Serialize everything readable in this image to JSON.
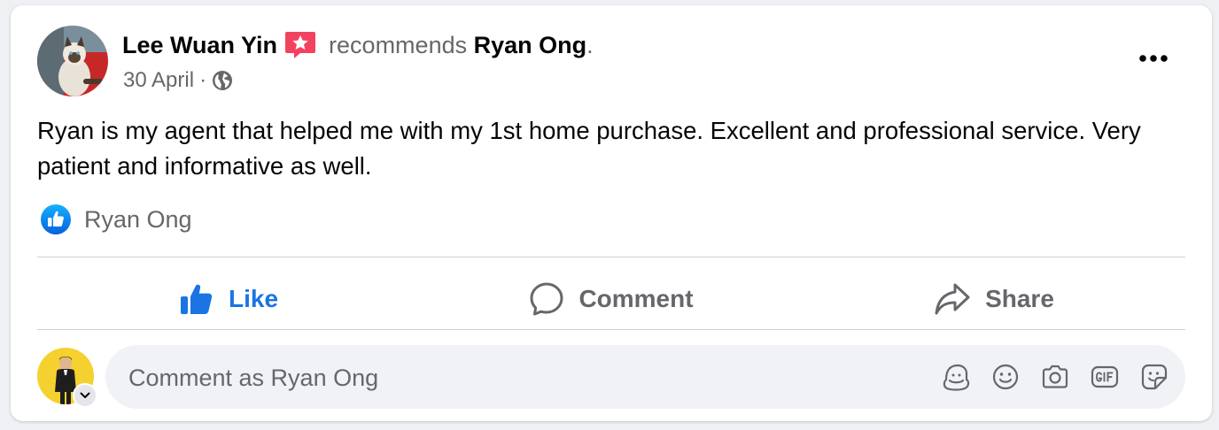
{
  "post": {
    "author": "Lee Wuan Yin",
    "verb": "recommends",
    "page": "Ryan Ong",
    "period": ".",
    "date": "30 April",
    "separator": "·",
    "privacy_icon": "globe-icon",
    "body": "Ryan is my agent that helped me with my 1st home purchase. Excellent and professional service. Very patient and informative as well.",
    "more_icon": "more-horizontal-icon"
  },
  "reactions": {
    "icon": "like-reaction-icon",
    "name": "Ryan Ong"
  },
  "actions": {
    "like": "Like",
    "comment": "Comment",
    "share": "Share"
  },
  "comment_box": {
    "placeholder": "Comment as Ryan Ong",
    "tools": [
      "avatar-sticker-icon",
      "emoji-icon",
      "camera-icon",
      "gif-icon",
      "sticker-icon"
    ]
  },
  "colors": {
    "accent": "#1b74e4",
    "muted": "#65676b",
    "recommend": "#f3425f"
  }
}
